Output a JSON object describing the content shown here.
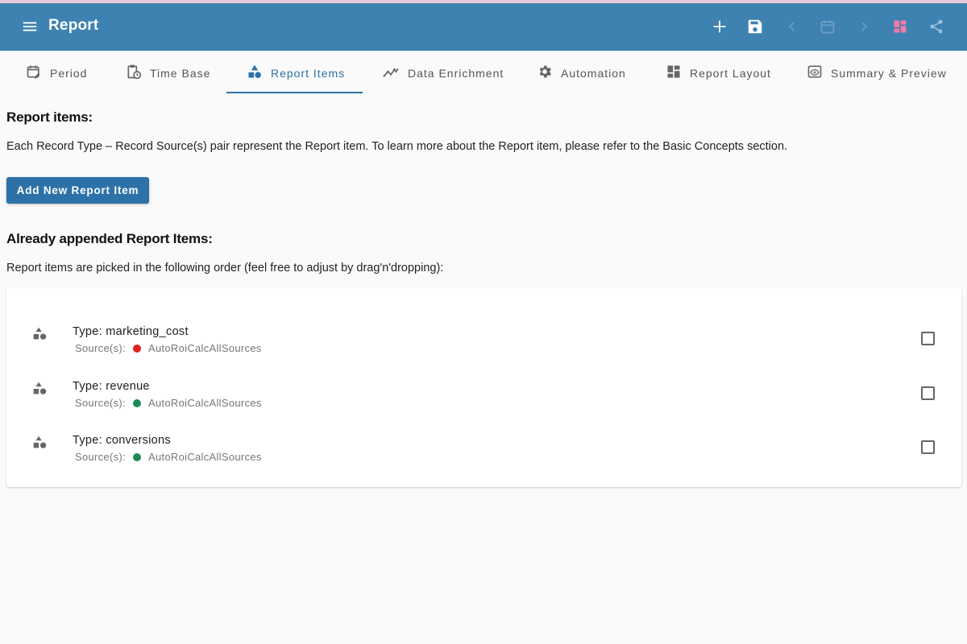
{
  "appbar": {
    "title": "Report",
    "bg_color": "#3d82b0",
    "icons": [
      "menu-icon",
      "plus-icon",
      "save-icon",
      "chevron-left-icon",
      "calendar-icon",
      "chevron-right-icon",
      "layout-icon",
      "share-icon"
    ]
  },
  "tabs": [
    {
      "label": "Period",
      "icon": "calendar-edit-icon"
    },
    {
      "label": "Time Base",
      "icon": "clipboard-clock-icon"
    },
    {
      "label": "Report Items",
      "icon": "shapes-icon",
      "active": true
    },
    {
      "label": "Data Enrichment",
      "icon": "trend-icon"
    },
    {
      "label": "Automation",
      "icon": "gear-icon"
    },
    {
      "label": "Report Layout",
      "icon": "dashboard-icon"
    },
    {
      "label": "Summary & Preview",
      "icon": "eye-icon"
    }
  ],
  "section1": {
    "heading": "Report items:",
    "description": "Each Record Type – Record Source(s) pair represent the Report item. To learn more about the Report item, please refer to the Basic Concepts section.",
    "add_button": "Add New Report Item"
  },
  "section2": {
    "heading": "Already appended Report Items:",
    "description": "Report items are picked in the following order (feel free to adjust by drag'n'dropping):"
  },
  "items": [
    {
      "type": "Type: marketing_cost",
      "source_label": "Source(s):",
      "source": "AutoRoiCalcAllSources",
      "status_color": "#e02020"
    },
    {
      "type": "Type: revenue",
      "source_label": "Source(s):",
      "source": "AutoRoiCalcAllSources",
      "status_color": "#1f8a55"
    },
    {
      "type": "Type: conversions",
      "source_label": "Source(s):",
      "source": "AutoRoiCalcAllSources",
      "status_color": "#1f8a55"
    }
  ],
  "colors": {
    "accent": "#2c72a8",
    "layout_icon": "#f27aa8"
  }
}
